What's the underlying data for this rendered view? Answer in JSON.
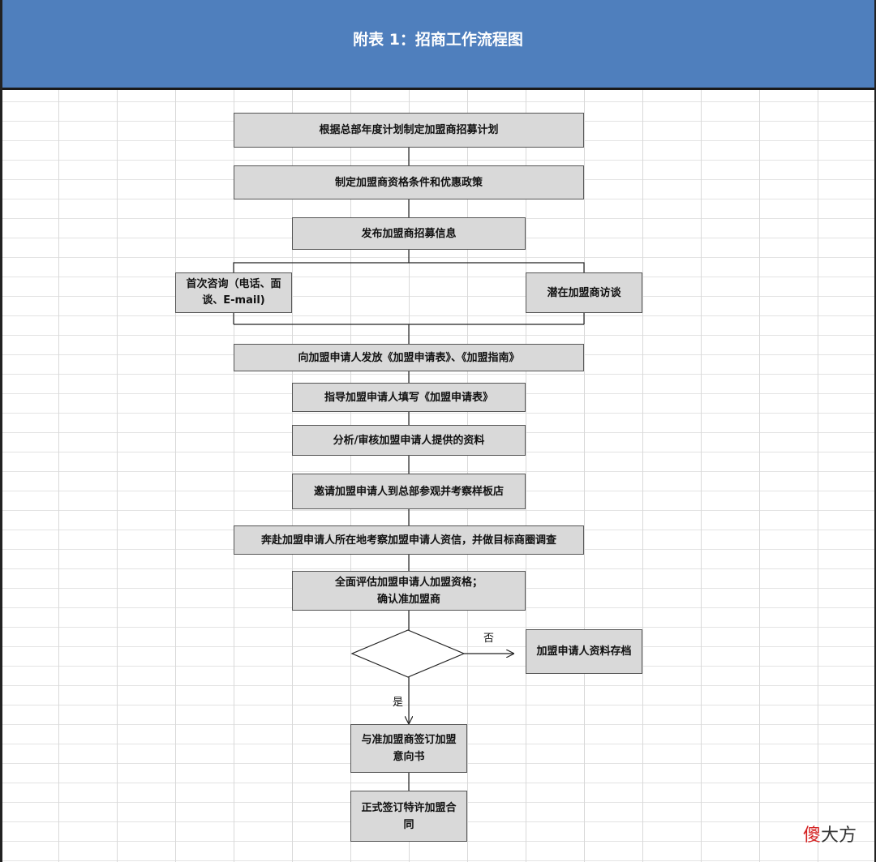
{
  "header": {
    "title": "附表 1：招商工作流程图"
  },
  "steps": {
    "s1": "根据总部年度计划制定加盟商招募计划",
    "s2": "制定加盟商资格条件和优惠政策",
    "s3": "发布加盟商招募信息",
    "s4a": "首次咨询（电话、面谈、E-mail)",
    "s4b": "潜在加盟商访谈",
    "s5": "向加盟申请人发放《加盟申请表》、《加盟指南》",
    "s6": "指导加盟申请人填写《加盟申请表》",
    "s7": "分析/审核加盟申请人提供的资料",
    "s8": "邀请加盟申请人到总部参观并考察样板店",
    "s9": "奔赴加盟申请人所在地考察加盟申请人资信，并做目标商圈调查",
    "s10_line1": "全面评估加盟申请人加盟资格；",
    "s10_line2": "确认准加盟商",
    "archive": "加盟申请人资料存档",
    "s11": "与准加盟商签订加盟意向书",
    "s12": "正式签订特许加盟合同"
  },
  "decision": {
    "no_label": "否",
    "yes_label": "是"
  },
  "watermark": {
    "char1": "傻",
    "rest": "大方"
  },
  "colors": {
    "header_bg": "#4f7fbd",
    "box_bg": "#d9d9d9",
    "watermark_red": "#d42020"
  }
}
